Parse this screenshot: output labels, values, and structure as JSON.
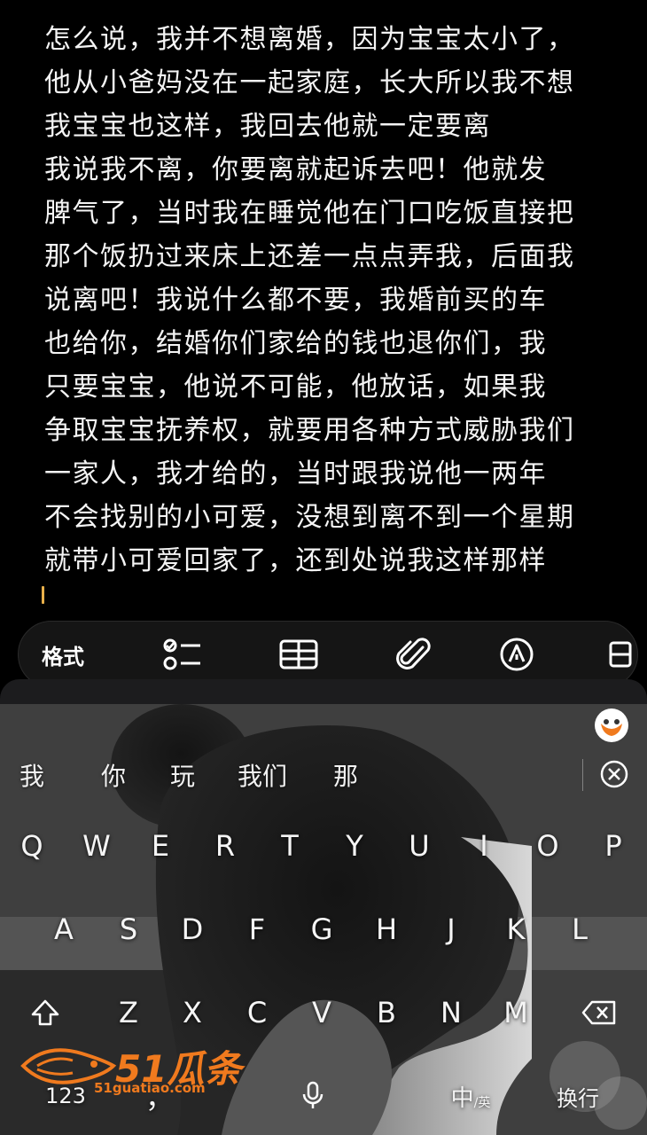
{
  "note": {
    "lines": [
      "怎么说，我并不想离婚，因为宝宝太小了，",
      "他从小爸妈没在一起家庭，长大所以我不想",
      "我宝宝也这样，我回去他就一定要离",
      "我说我不离，你要离就起诉去吧！他就发",
      "脾气了，当时我在睡觉他在门口吃饭直接把",
      "那个饭扔过来床上还差一点点弄我，后面我",
      "说离吧！我说什么都不要，我婚前买的车",
      "也给你，结婚你们家给的钱也退你们，我",
      "只要宝宝，他说不可能，他放话，如果我",
      "争取宝宝抚养权，就要用各种方式威胁我们",
      "一家人，我才给的，当时跟我说他一两年",
      "不会找别的小可爱，没想到离不到一个星期",
      "就带小可爱回家了，还到处说我这样那样"
    ],
    "caret_color": "#e8b04a"
  },
  "toolbar": {
    "format_label": "格式",
    "icons": [
      "checklist-icon",
      "table-icon",
      "attachment-icon",
      "pen-icon",
      "more-icon"
    ]
  },
  "keyboard": {
    "candidates": [
      "我",
      "你",
      "玩",
      "我们",
      "那"
    ],
    "row1": [
      "Q",
      "W",
      "E",
      "R",
      "T",
      "Y",
      "U",
      "I",
      "O",
      "P"
    ],
    "row2": [
      "A",
      "S",
      "D",
      "F",
      "G",
      "H",
      "J",
      "K",
      "L"
    ],
    "row3": [
      "Z",
      "X",
      "C",
      "V",
      "B",
      "N",
      "M"
    ],
    "numeric_label": "123",
    "comma_label": "，",
    "lang_label_main": "中",
    "lang_label_sub": "/英",
    "enter_label": "换行"
  },
  "watermark": {
    "brand": "51瓜条",
    "url": "51guatiao.com",
    "color": "#f07a1e"
  }
}
